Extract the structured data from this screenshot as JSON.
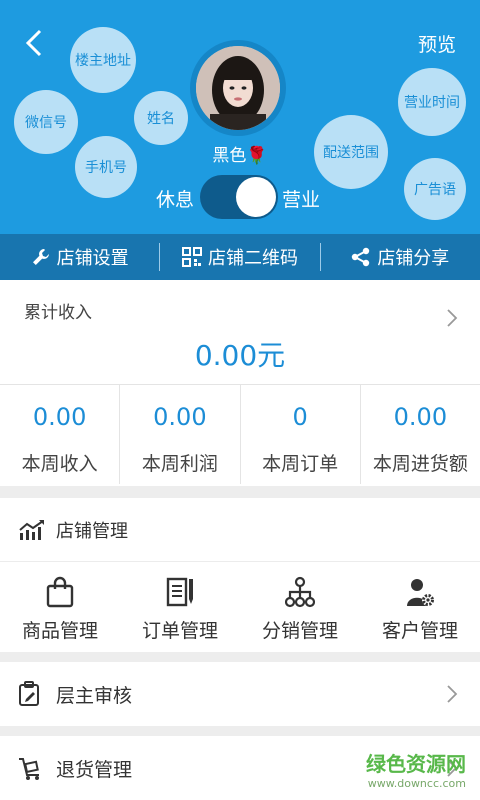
{
  "header": {
    "back_icon": "chevron-left-icon",
    "preview_label": "预览",
    "bubbles": {
      "owner_address": "楼主地址",
      "wechat": "微信号",
      "name": "姓名",
      "phone": "手机号",
      "business_hours": "营业时间",
      "delivery_range": "配送范围",
      "slogan": "广告语"
    },
    "shop_name": "黑色",
    "shop_emoji": "🌹",
    "toggle": {
      "off_label": "休息",
      "on_label": "营业",
      "state": "on"
    },
    "colors": {
      "bg": "#1e9be0",
      "bubble": "#b9e0f6",
      "tabbar": "#1875af"
    }
  },
  "tabs": [
    {
      "label": "店铺设置",
      "icon": "wrench-icon"
    },
    {
      "label": "店铺二维码",
      "icon": "qrcode-icon"
    },
    {
      "label": "店铺分享",
      "icon": "share-icon"
    }
  ],
  "income": {
    "title": "累计收入",
    "total": "0.00元",
    "stats": [
      {
        "value": "0.00",
        "label": "本周收入"
      },
      {
        "value": "0.00",
        "label": "本周利润"
      },
      {
        "value": "0",
        "label": "本周订单"
      },
      {
        "value": "0.00",
        "label": "本周进货额"
      }
    ]
  },
  "management": {
    "title": "店铺管理",
    "items": [
      {
        "label": "商品管理",
        "icon": "shopping-bag-icon"
      },
      {
        "label": "订单管理",
        "icon": "document-pen-icon"
      },
      {
        "label": "分销管理",
        "icon": "network-tree-icon"
      },
      {
        "label": "客户管理",
        "icon": "user-gear-icon"
      }
    ]
  },
  "rows": [
    {
      "label": "层主审核",
      "icon": "clipboard-pen-icon"
    },
    {
      "label": "退货管理",
      "icon": "return-cart-icon"
    }
  ],
  "watermark": {
    "line1": "绿色资源网",
    "line2": "www.downcc.com"
  }
}
